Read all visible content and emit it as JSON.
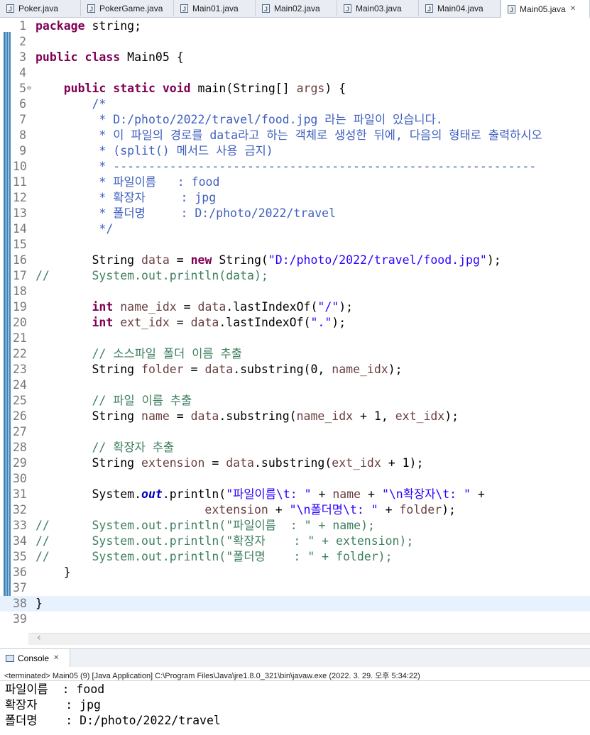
{
  "tabs": [
    {
      "label": "Poker.java",
      "active": false
    },
    {
      "label": "PokerGame.java",
      "active": false
    },
    {
      "label": "Main01.java",
      "active": false
    },
    {
      "label": "Main02.java",
      "active": false
    },
    {
      "label": "Main03.java",
      "active": false
    },
    {
      "label": "Main04.java",
      "active": false
    },
    {
      "label": "Main05.java",
      "active": true
    }
  ],
  "code_lines": [
    "package string;",
    "",
    "public class Main05 {",
    "",
    "    public static void main(String[] args) {",
    "        /*",
    "         * D:/photo/2022/travel/food.jpg 라는 파일이 있습니다.",
    "         * 이 파일의 경로를 data라고 하는 객체로 생성한 뒤에, 다음의 형태로 출력하시오",
    "         * (split() 메서드 사용 금지)",
    "         * ------------------------------------------------------------",
    "         * 파일이름   : food",
    "         * 확장자     : jpg",
    "         * 폴더명     : D:/photo/2022/travel",
    "         */",
    "",
    "        String data = new String(\"D:/photo/2022/travel/food.jpg\");",
    "//      System.out.println(data);",
    "",
    "        int name_idx = data.lastIndexOf(\"/\");",
    "        int ext_idx = data.lastIndexOf(\".\");",
    "",
    "        // 소스파일 폴더 이름 추출",
    "        String folder = data.substring(0, name_idx);",
    "",
    "        // 파일 이름 추출",
    "        String name = data.substring(name_idx + 1, ext_idx);",
    "",
    "        // 확장자 추출",
    "        String extension = data.substring(ext_idx + 1);",
    "",
    "        System.out.println(\"파일이름\\t: \" + name + \"\\n확장자\\t: \" +",
    "                        extension + \"\\n폴더명\\t: \" + folder);",
    "//      System.out.println(\"파일이름  : \" + name);",
    "//      System.out.println(\"확장자    : \" + extension);",
    "//      System.out.println(\"폴더명    : \" + folder);",
    "    }",
    "",
    "}",
    ""
  ],
  "current_line": 38,
  "console": {
    "tab_label": "Console",
    "status": "<terminated> Main05 (9) [Java Application] C:\\Program Files\\Java\\jre1.8.0_321\\bin\\javaw.exe (2022. 3. 29. 오후 5:34:22)",
    "output": [
      "파일이름  : food",
      "확장자    : jpg",
      "폴더명    : D:/photo/2022/travel"
    ]
  }
}
